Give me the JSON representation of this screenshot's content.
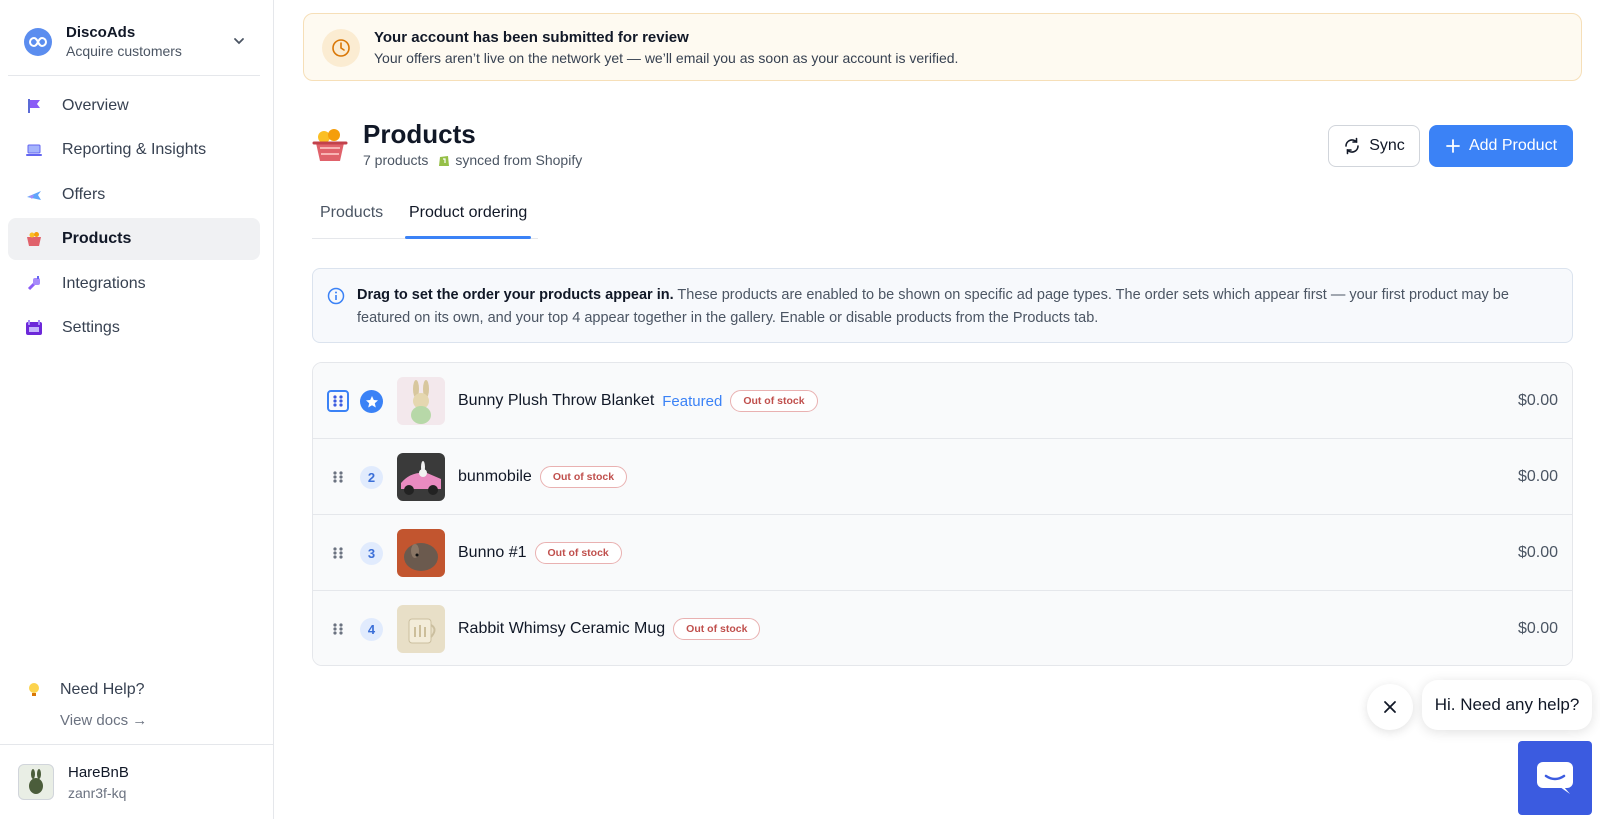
{
  "brand": {
    "name": "DiscoAds",
    "subtitle": "Acquire customers"
  },
  "nav": [
    {
      "label": "Overview",
      "icon": "flag-icon"
    },
    {
      "label": "Reporting & Insights",
      "icon": "laptop-icon"
    },
    {
      "label": "Offers",
      "icon": "plane-icon"
    },
    {
      "label": "Products",
      "icon": "basket-icon",
      "active": true
    },
    {
      "label": "Integrations",
      "icon": "plug-icon"
    },
    {
      "label": "Settings",
      "icon": "gear-icon"
    }
  ],
  "help": {
    "label": "Need Help?",
    "docs": "View docs →"
  },
  "account": {
    "name": "HareBnB",
    "id": "zanr3f-kq"
  },
  "banner": {
    "title": "Your account has been submitted for review",
    "text": "Your offers aren’t live on the network yet — we’ll email you as soon as your account is verified."
  },
  "page": {
    "title": "Products",
    "count": "7 products",
    "synced": "synced from Shopify",
    "sync_label": "Sync",
    "add_label": "Add Product"
  },
  "tabs": [
    {
      "label": "Products"
    },
    {
      "label": "Product ordering",
      "active": true
    }
  ],
  "info": {
    "bold": "Drag to set the order your products appear in.",
    "text": " These products are enabled to be shown on specific ad page types. The order sets which appear first — your first product may be featured on its own, and your top 4 appear together in the gallery. Enable or disable products from the Products tab."
  },
  "products": [
    {
      "rank": "",
      "name": "Bunny Plush Throw Blanket",
      "featured": "Featured",
      "badge": "Out of stock",
      "price": "$0.00"
    },
    {
      "rank": "2",
      "name": "bunmobile",
      "featured": "",
      "badge": "Out of stock",
      "price": "$0.00"
    },
    {
      "rank": "3",
      "name": "Bunno #1",
      "featured": "",
      "badge": "Out of stock",
      "price": "$0.00"
    },
    {
      "rank": "4",
      "name": "Rabbit Whimsy Ceramic Mug",
      "featured": "",
      "badge": "Out of stock",
      "price": "$0.00"
    }
  ],
  "chat": {
    "greeting": "Hi. Need any help?"
  },
  "colors": {
    "accent": "#3b82f6",
    "badge": "#c0504d",
    "banner_bg": "#fefaf1"
  }
}
